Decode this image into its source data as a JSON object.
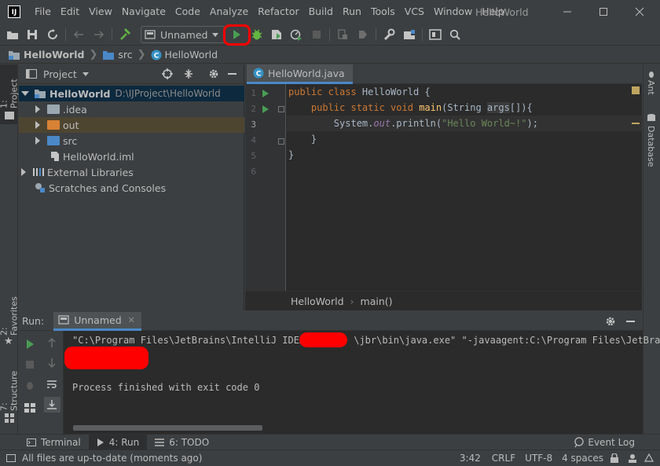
{
  "app": {
    "logo": "IJ",
    "window_title": "HelloWorld"
  },
  "menu": [
    "File",
    "Edit",
    "View",
    "Navigate",
    "Code",
    "Analyze",
    "Refactor",
    "Build",
    "Run",
    "Tools",
    "VCS",
    "Window",
    "Help"
  ],
  "toolbar": {
    "run_config": "Unnamed",
    "run_button_highlight_color": "#ff0000"
  },
  "breadcrumbs": [
    "HelloWorld",
    "src",
    "HelloWorld"
  ],
  "left_stripe": {
    "project_tab": "1: Project",
    "favorites_tab": "2: Favorites",
    "structure_tab": "7: Structure"
  },
  "right_stripe": {
    "ant_tab": "Ant",
    "database_tab": "Database"
  },
  "project_panel": {
    "title": "Project",
    "tree": [
      {
        "label": "HelloWorld",
        "path": "D:\\IJProject\\HelloWorld"
      },
      {
        "label": ".idea"
      },
      {
        "label": "out"
      },
      {
        "label": "src"
      },
      {
        "label": "HelloWorld.iml"
      },
      {
        "label": "External Libraries"
      },
      {
        "label": "Scratches and Consoles"
      }
    ]
  },
  "editor": {
    "tab": "HelloWorld.java",
    "line_numbers": [
      "1",
      "2",
      "3",
      "4",
      "5",
      "6"
    ],
    "breadcrumb_class": "HelloWorld",
    "breadcrumb_method": "main()"
  },
  "code": {
    "l1_kw": "public class ",
    "l1_name": "HelloWorld {",
    "l2_indent": "    ",
    "l2_kw": "public static void ",
    "l2_fn": "main",
    "l2_a": "(String ",
    "l2_param": "args",
    "l2_b": "[]){",
    "l3_indent": "        ",
    "l3_a": "System.",
    "l3_out": "out",
    "l3_b": ".println(",
    "l3_str": "\"Hello World~!\"",
    "l3_c": ");",
    "l4": "    }",
    "l5": "}"
  },
  "run_panel": {
    "label": "Run:",
    "tab": "Unnamed",
    "console_line1a": "\"C:\\Program Files\\JetBrains\\IntelliJ IDEA",
    "console_line1b": "\\jbr\\bin\\java.exe\" \"-javaagent:C:\\Program Files\\JetBra",
    "console_finished": "Process finished with exit code 0",
    "redaction_color": "#ff0000"
  },
  "bottom_tabs": {
    "terminal": "Terminal",
    "run": "4: Run",
    "todo": "6: TODO",
    "event_log": "Event Log"
  },
  "status": {
    "message": "All files are up-to-date (moments ago)",
    "position": "3:42",
    "line_sep": "CRLF",
    "encoding": "UTF-8",
    "indent": "4 spaces"
  }
}
